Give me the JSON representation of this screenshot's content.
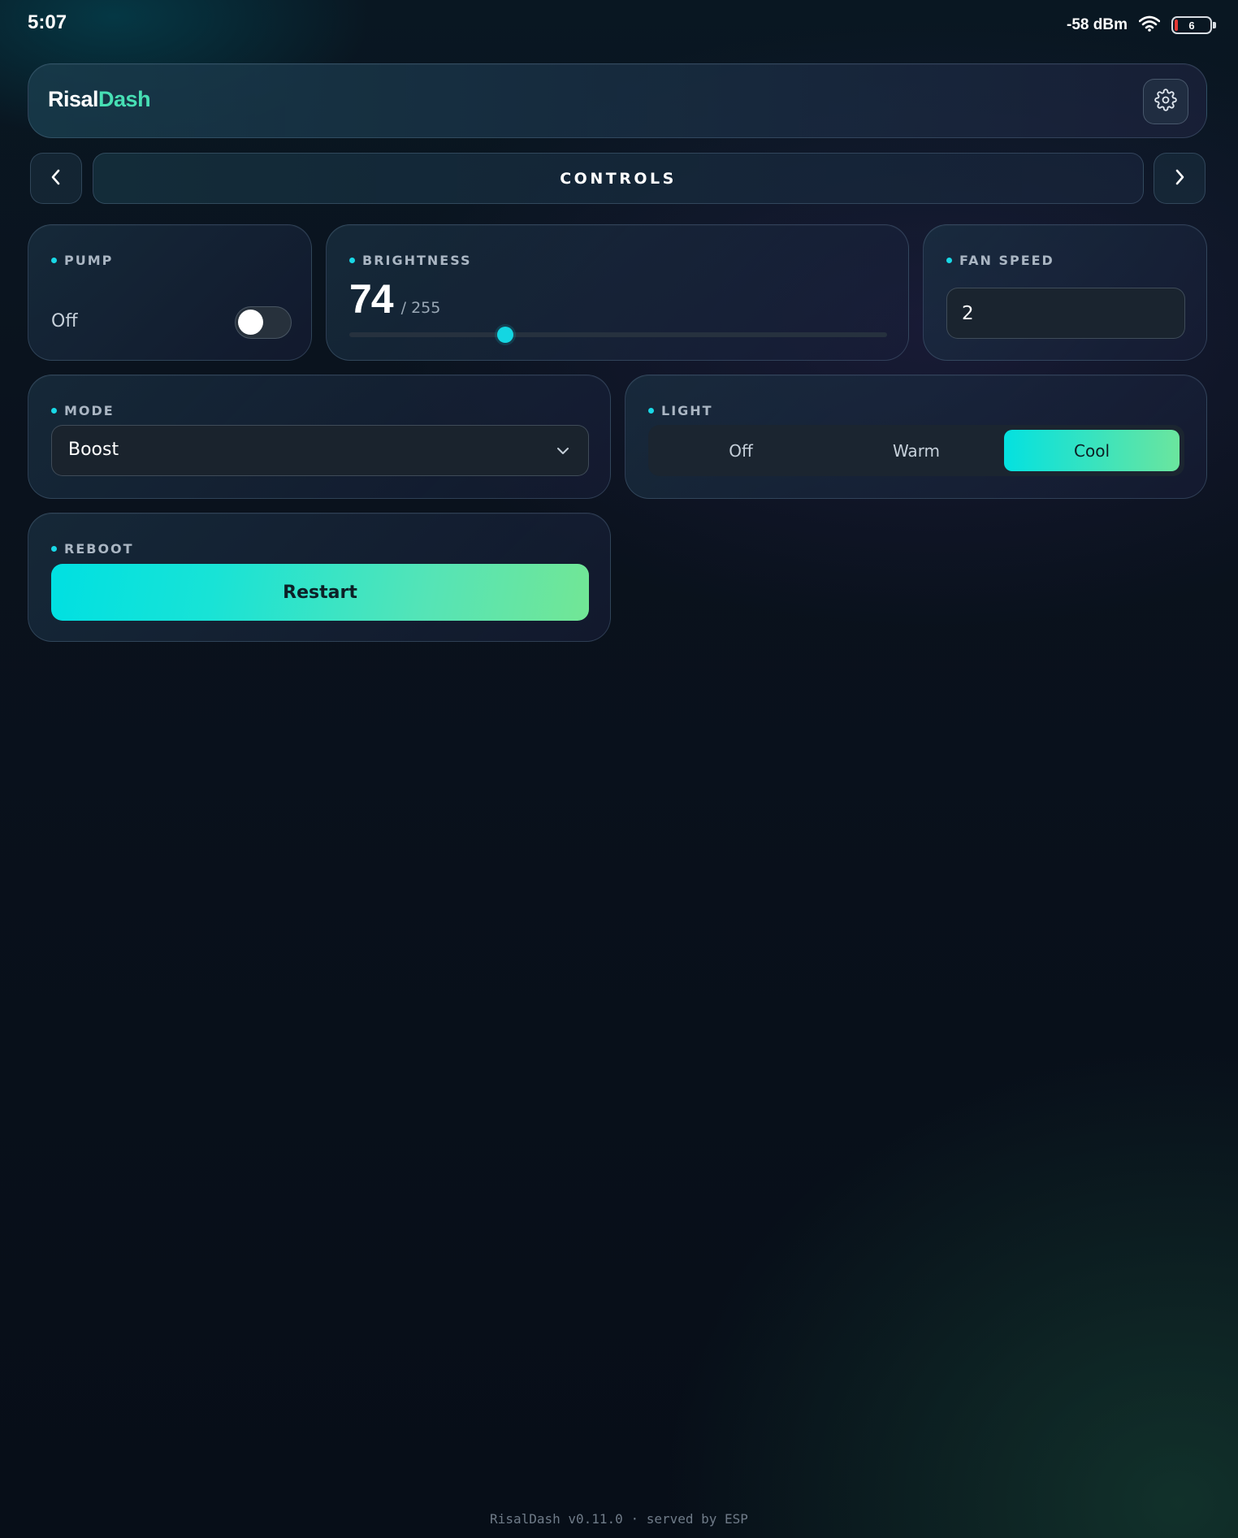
{
  "status_bar": {
    "time": "5:07",
    "signal": "-58 dBm",
    "battery_level": "6"
  },
  "header": {
    "brand_part1": "Risal",
    "brand_part2": "Dash",
    "settings_icon": "gear-icon"
  },
  "nav": {
    "title": "CONTROLS",
    "prev_icon": "chevron-left-icon",
    "next_icon": "chevron-right-icon"
  },
  "pump": {
    "label": "PUMP",
    "state": "Off",
    "on": false
  },
  "brightness": {
    "label": "BRIGHTNESS",
    "value": "74",
    "max": "/ 255",
    "level": 74,
    "range_max": 255
  },
  "fan_speed": {
    "label": "FAN SPEED",
    "value": "2"
  },
  "mode": {
    "label": "MODE",
    "selected": "Boost"
  },
  "light": {
    "label": "LIGHT",
    "options": [
      "Off",
      "Warm",
      "Cool"
    ],
    "selected": "Cool"
  },
  "reboot": {
    "label": "REBOOT",
    "button": "Restart"
  },
  "footer": {
    "text": "RisalDash v0.11.0 · served by ESP"
  },
  "colors": {
    "accent_cyan": "#14d6e2",
    "accent_green": "#47dfb4"
  }
}
